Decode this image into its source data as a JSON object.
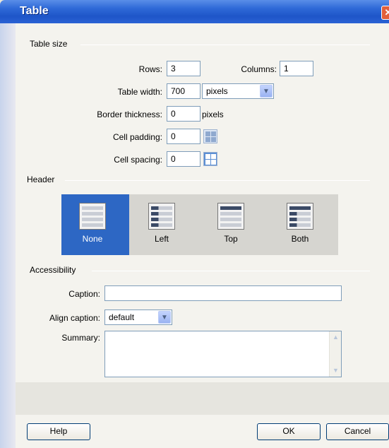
{
  "dialog": {
    "title": "Table",
    "close_glyph": "✕"
  },
  "table_size": {
    "section_label": "Table size",
    "rows_label": "Rows:",
    "rows_value": "3",
    "columns_label": "Columns:",
    "columns_value": "1",
    "width_label": "Table width:",
    "width_value": "700",
    "width_unit": "pixels",
    "border_label": "Border thickness:",
    "border_value": "0",
    "border_unit": "pixels",
    "padding_label": "Cell padding:",
    "padding_value": "0",
    "spacing_label": "Cell spacing:",
    "spacing_value": "0"
  },
  "header": {
    "section_label": "Header",
    "options": [
      {
        "label": "None",
        "selected": true
      },
      {
        "label": "Left",
        "selected": false
      },
      {
        "label": "Top",
        "selected": false
      },
      {
        "label": "Both",
        "selected": false
      }
    ]
  },
  "accessibility": {
    "section_label": "Accessibility",
    "caption_label": "Caption:",
    "caption_value": "",
    "align_label": "Align caption:",
    "align_value": "default",
    "summary_label": "Summary:",
    "summary_value": ""
  },
  "buttons": {
    "help": "Help",
    "ok": "OK",
    "cancel": "Cancel"
  },
  "colors": {
    "selected_header": "#2d67c4",
    "titlebar": "#1e55c8"
  }
}
